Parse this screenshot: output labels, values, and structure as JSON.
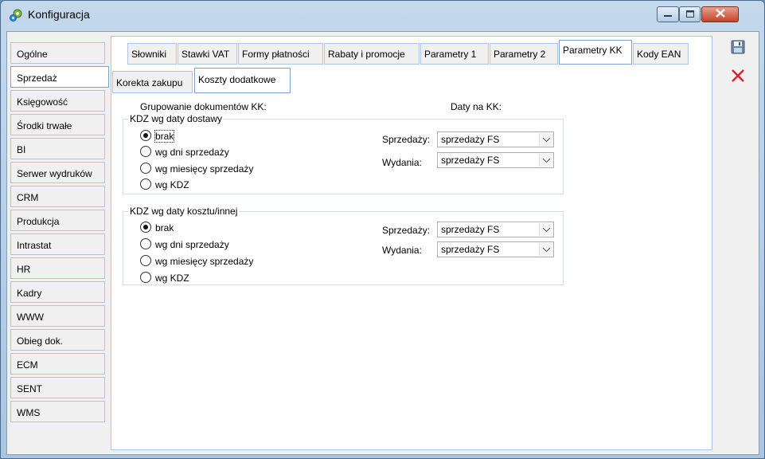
{
  "window": {
    "title": "Konfiguracja"
  },
  "sidebar": {
    "items": [
      {
        "label": "Ogólne"
      },
      {
        "label": "Sprzedaż"
      },
      {
        "label": "Księgowość"
      },
      {
        "label": "Środki trwałe"
      },
      {
        "label": "BI"
      },
      {
        "label": "Serwer wydruków"
      },
      {
        "label": "CRM"
      },
      {
        "label": "Produkcja"
      },
      {
        "label": "Intrastat"
      },
      {
        "label": "HR"
      },
      {
        "label": "Kadry"
      },
      {
        "label": "WWW"
      },
      {
        "label": "Obieg dok."
      },
      {
        "label": "ECM"
      },
      {
        "label": "SENT"
      },
      {
        "label": "WMS"
      }
    ],
    "active_index": 1
  },
  "tabs": [
    {
      "label": "Słowniki"
    },
    {
      "label": "Stawki VAT"
    },
    {
      "label": "Formy płatności"
    },
    {
      "label": "Rabaty i promocje"
    },
    {
      "label": "Parametry 1"
    },
    {
      "label": "Parametry 2"
    },
    {
      "label": "Parametry KK"
    },
    {
      "label": "Kody EAN"
    }
  ],
  "subtabs": [
    {
      "label": "Korekta zakupu"
    },
    {
      "label": "Koszty dodatkowe"
    }
  ],
  "main": {
    "grouping_label": "Grupowanie dokumentów KK:",
    "dates_label": "Daty na KK:",
    "group1": {
      "title": "KDZ wg daty dostawy",
      "options": [
        "brak",
        "wg dni sprzedaży",
        "wg miesięcy sprzedaży",
        "wg KDZ"
      ],
      "selected": "brak",
      "sale_label": "Sprzedaży:",
      "sale_value": "sprzedaży FS",
      "issue_label": "Wydania:",
      "issue_value": "sprzedaży FS"
    },
    "group2": {
      "title": "KDZ wg daty kosztu/innej",
      "options": [
        "brak",
        "wg dni sprzedaży",
        "wg miesięcy sprzedaży",
        "wg KDZ"
      ],
      "selected": "brak",
      "sale_label": "Sprzedaży:",
      "sale_value": "sprzedaży FS",
      "issue_label": "Wydania:",
      "issue_value": "sprzedaży FS"
    }
  },
  "toolbar": {
    "save_icon": "save-icon",
    "close_icon": "close-icon"
  },
  "colors": {
    "tab_border": "#a9c6ea",
    "active_border": "#7da2ce",
    "close_red": "#d9232a"
  }
}
